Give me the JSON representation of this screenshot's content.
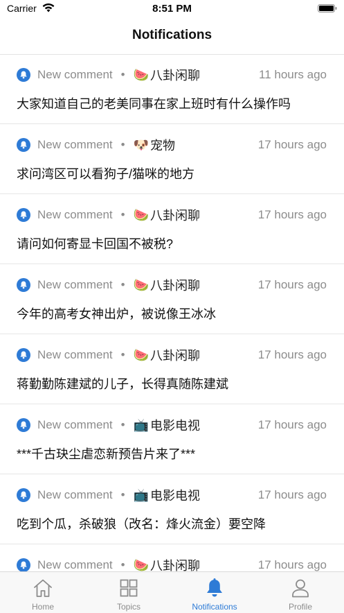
{
  "status_bar": {
    "carrier": "Carrier",
    "time": "8:51 PM"
  },
  "nav": {
    "title": "Notifications"
  },
  "notifications": [
    {
      "type": "New comment",
      "node_icon": "🍉",
      "node": "八卦闲聊",
      "time": "11 hours ago",
      "title": "大家知道自己的老美同事在家上班时有什么操作吗"
    },
    {
      "type": "New comment",
      "node_icon": "🐶",
      "node": "宠物",
      "time": "17 hours ago",
      "title": "求问湾区可以看狗子/猫咪的地方"
    },
    {
      "type": "New comment",
      "node_icon": "🍉",
      "node": "八卦闲聊",
      "time": "17 hours ago",
      "title": "请问如何寄显卡回国不被税?"
    },
    {
      "type": "New comment",
      "node_icon": "🍉",
      "node": "八卦闲聊",
      "time": "17 hours ago",
      "title": "今年的高考女神出炉，被说像王冰冰"
    },
    {
      "type": "New comment",
      "node_icon": "🍉",
      "node": "八卦闲聊",
      "time": "17 hours ago",
      "title": "蒋勤勤陈建斌的儿子，长得真随陈建斌"
    },
    {
      "type": "New comment",
      "node_icon": "📺",
      "node": "电影电视",
      "time": "17 hours ago",
      "title": "***千古玦尘虐恋新预告片来了***"
    },
    {
      "type": "New comment",
      "node_icon": "📺",
      "node": "电影电视",
      "time": "17 hours ago",
      "title": "吃到个瓜，杀破狼（改名：烽火流金）要空降"
    },
    {
      "type": "New comment",
      "node_icon": "🍉",
      "node": "八卦闲聊",
      "time": "17 hours ago",
      "title": ""
    }
  ],
  "tabs": [
    {
      "label": "Home",
      "icon": "home-icon"
    },
    {
      "label": "Topics",
      "icon": "grid-icon"
    },
    {
      "label": "Notifications",
      "icon": "bell-icon",
      "active": true
    },
    {
      "label": "Profile",
      "icon": "person-icon"
    }
  ],
  "colors": {
    "accent": "#2e7bd6",
    "secondary_text": "#8c8c8c",
    "separator": "#e6e6e6"
  }
}
